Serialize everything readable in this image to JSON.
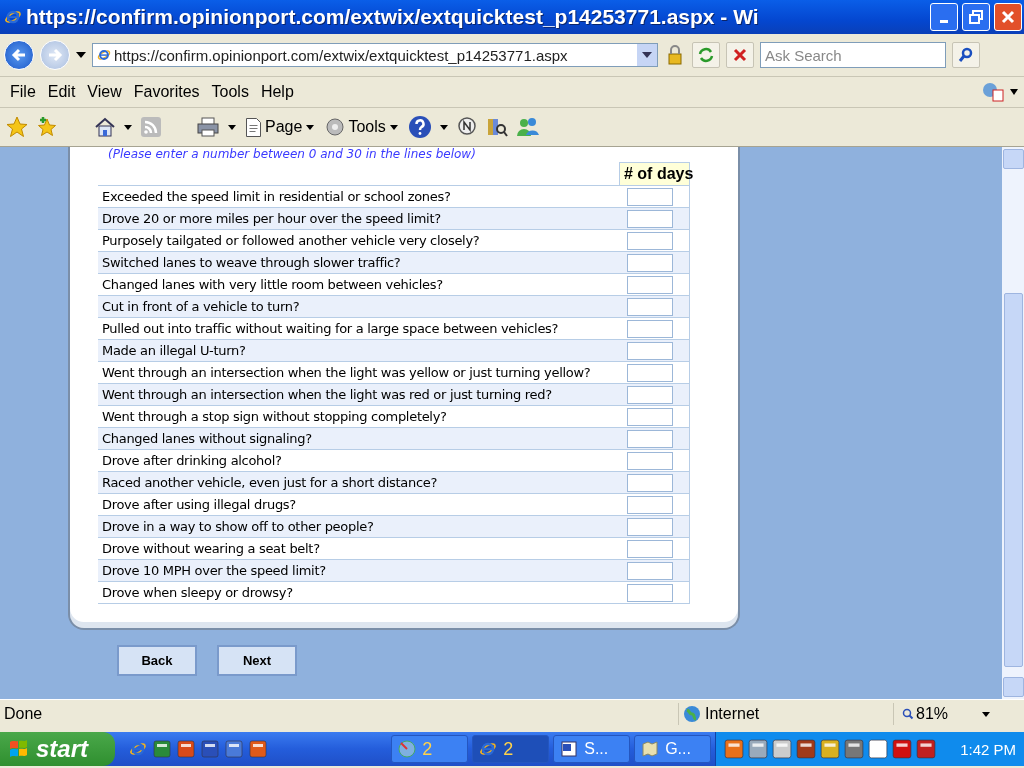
{
  "window": {
    "title": "https://confirm.opinionport.com/extwix/extquicktest_p14253771.aspx - Wi"
  },
  "address_bar": {
    "url": "https://confirm.opinionport.com/extwix/extquicktest_p14253771.aspx"
  },
  "search": {
    "placeholder": "Ask Search"
  },
  "menu": [
    "File",
    "Edit",
    "View",
    "Favorites",
    "Tools",
    "Help"
  ],
  "toolbar": [
    {
      "kind": "page",
      "label": "Page"
    },
    {
      "kind": "tools",
      "label": "Tools"
    }
  ],
  "survey": {
    "instruction": "(Please enter a number between 0 and 30 in the lines below)",
    "column_header": "# of days",
    "questions": [
      {
        "text": "Exceeded the speed limit in residential or school zones?"
      },
      {
        "text": "Drove 20 or more miles per hour over the speed limit?"
      },
      {
        "text": "Purposely tailgated or followed another vehicle very closely?"
      },
      {
        "text": "Switched lanes to weave through slower traffic?"
      },
      {
        "text": "Changed lanes with very little room between vehicles?"
      },
      {
        "text": "Cut in front of a vehicle to turn?"
      },
      {
        "text": "Pulled out into traffic without waiting for a large space between vehicles?"
      },
      {
        "text": "Made an illegal U-turn?"
      },
      {
        "text": "Went through an intersection when the light was yellow or just turning yellow?"
      },
      {
        "text": "Went through an intersection when the light was red or just turning red?"
      },
      {
        "text": "Went through a stop sign without stopping completely?"
      },
      {
        "text": "Changed lanes without signaling?"
      },
      {
        "text": "Drove after drinking alcohol?"
      },
      {
        "text": "Raced another vehicle, even just for a short distance?"
      },
      {
        "text": "Drove after using illegal drugs?"
      },
      {
        "text": "Drove in a way to show off to other people?"
      },
      {
        "text": "Drove without wearing a seat belt?"
      },
      {
        "text": "Drove 10 MPH over the speed limit?"
      },
      {
        "text": "Drove when sleepy or drowsy?"
      }
    ]
  },
  "buttons": [
    "Back",
    "Next"
  ],
  "status_bar": {
    "text": "Done",
    "zone": "Internet",
    "zoom": "81%"
  },
  "taskbar": {
    "start": "start",
    "tasks": [
      {
        "kind": "globe",
        "label": "2",
        "selected": false
      },
      {
        "kind": "ie",
        "label": "2",
        "selected": true
      },
      {
        "kind": "word",
        "label": "S...",
        "selected": false
      },
      {
        "kind": "map",
        "label": "G...",
        "selected": false
      }
    ],
    "clock": "1:42 PM"
  }
}
